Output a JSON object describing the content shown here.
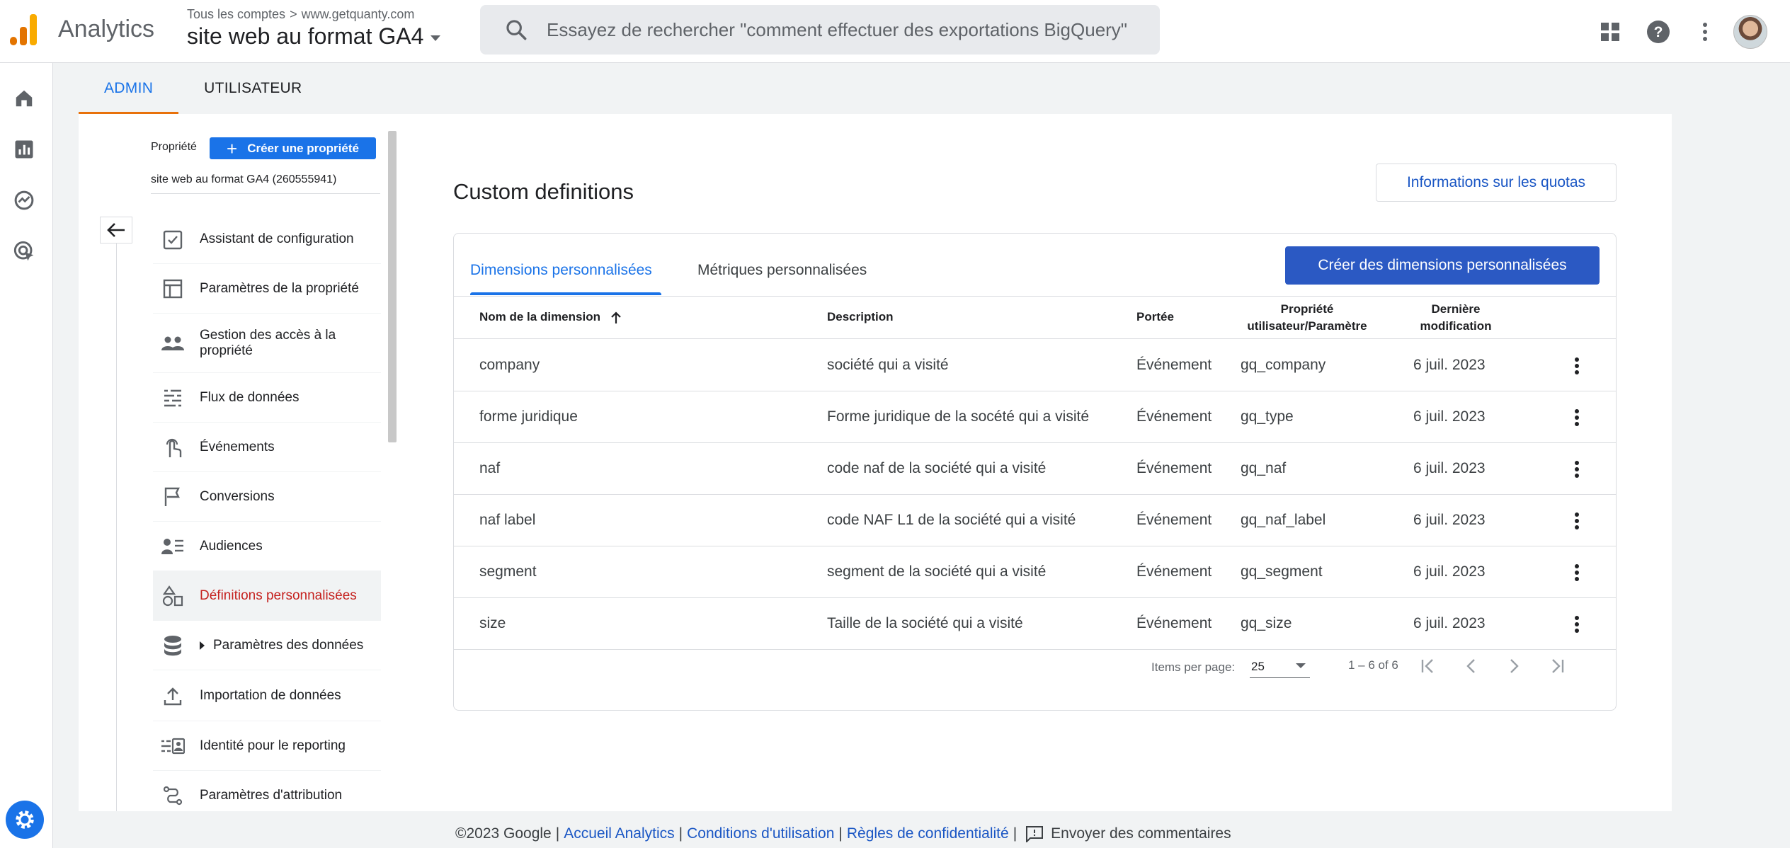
{
  "header": {
    "app_name": "Analytics",
    "breadcrumb_root": "Tous les comptes",
    "breadcrumb_separator": ">",
    "breadcrumb_account": "www.getquanty.com",
    "property": "site web au format GA4",
    "search_placeholder": "Essayez de rechercher \"comment effectuer des exportations BigQuery\"",
    "icons": [
      "apps-grid-icon",
      "help-icon",
      "more-vert-icon",
      "avatar"
    ],
    "logo_colors": [
      "#f9ab00",
      "#e37400",
      "#e37400"
    ]
  },
  "rail": {
    "icons": [
      "home-icon",
      "reports-icon",
      "explore-icon",
      "advertising-icon",
      "settings-icon"
    ]
  },
  "admin_tabs": [
    {
      "label": "ADMIN",
      "active": true
    },
    {
      "label": "UTILISATEUR",
      "active": false
    }
  ],
  "left_panel": {
    "property_label": "Propriété",
    "create_property_label": "Créer une propriété",
    "property_name": "site web au format GA4 (260555941)",
    "items": [
      {
        "label": "Assistant de configuration",
        "icon": "checklist-icon"
      },
      {
        "label": "Paramètres de la propriété",
        "icon": "property-settings-icon"
      },
      {
        "label": "Gestion des accès à la propriété",
        "icon": "people-icon"
      },
      {
        "label": "Flux de données",
        "icon": "data-streams-icon"
      },
      {
        "label": "Événements",
        "icon": "touch-icon"
      },
      {
        "label": "Conversions",
        "icon": "flag-icon"
      },
      {
        "label": "Audiences",
        "icon": "audiences-icon"
      },
      {
        "label": "Définitions personnalisées",
        "icon": "shapes-icon",
        "active": true
      },
      {
        "label": "Paramètres des données",
        "icon": "database-icon",
        "expandable": true
      },
      {
        "label": "Importation de données",
        "icon": "upload-icon"
      },
      {
        "label": "Identité pour le reporting",
        "icon": "identity-icon"
      },
      {
        "label": "Paramètres d'attribution",
        "icon": "attribution-icon"
      }
    ]
  },
  "content": {
    "title": "Custom definitions",
    "quota_button": "Informations sur les quotas",
    "tabs": [
      {
        "label": "Dimensions personnalisées",
        "active": true
      },
      {
        "label": "Métriques personnalisées",
        "active": false
      }
    ],
    "create_button": "Créer des dimensions personnalisées",
    "columns": {
      "name": "Nom de la dimension",
      "description": "Description",
      "scope": "Portée",
      "param_line1": "Propriété",
      "param_line2": "utilisateur/Paramètre",
      "modified_line1": "Dernière",
      "modified_line2": "modification"
    },
    "rows": [
      {
        "name": "company",
        "description": "société qui a visité",
        "scope": "Événement",
        "param": "gq_company",
        "modified": "6 juil. 2023"
      },
      {
        "name": "forme juridique",
        "description": "Forme juridique de la socété qui a visité",
        "scope": "Événement",
        "param": "gq_type",
        "modified": "6 juil. 2023"
      },
      {
        "name": "naf",
        "description": "code naf de la société qui a visité",
        "scope": "Événement",
        "param": "gq_naf",
        "modified": "6 juil. 2023"
      },
      {
        "name": "naf label",
        "description": "code NAF L1 de la société qui a visité",
        "scope": "Événement",
        "param": "gq_naf_label",
        "modified": "6 juil. 2023"
      },
      {
        "name": "segment",
        "description": "segment de la société qui a visité",
        "scope": "Événement",
        "param": "gq_segment",
        "modified": "6 juil. 2023"
      },
      {
        "name": "size",
        "description": "Taille de la société qui a visité",
        "scope": "Événement",
        "param": "gq_size",
        "modified": "6 juil. 2023"
      }
    ],
    "pager": {
      "items_per_page_label": "Items per page:",
      "items_per_page_value": "25",
      "range": "1 – 6 of 6"
    }
  },
  "footer": {
    "copyright": "©2023 Google",
    "links": [
      "Accueil Analytics",
      "Conditions d'utilisation",
      "Règles de confidentialité"
    ],
    "feedback": "Envoyer des commentaires"
  },
  "colors": {
    "accent_blue": "#1a73e8",
    "primary_button": "#2b59c3",
    "active_nav_text": "#c5221f",
    "tab_underline_orange": "#e8710a"
  }
}
